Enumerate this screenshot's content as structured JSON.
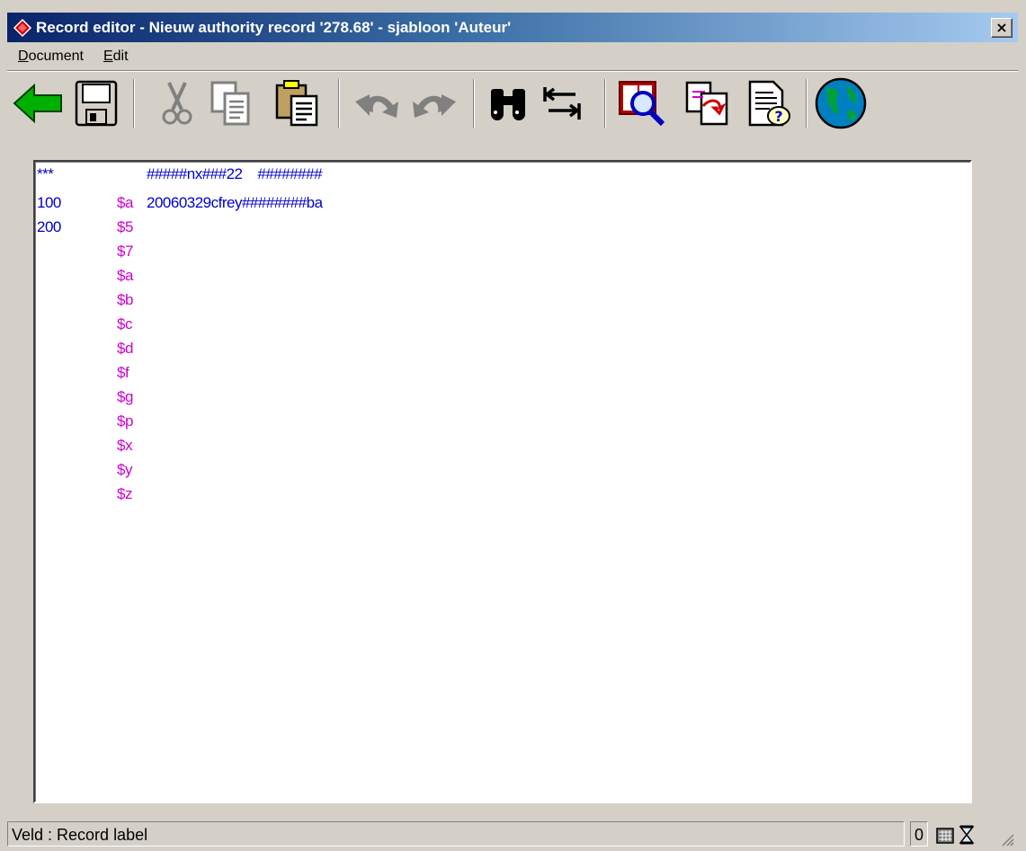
{
  "window": {
    "title": "Record editor - Nieuw authority record '278.68' - sjabloon 'Auteur'",
    "close_label": "×",
    "title_gradient": [
      "#0a246a",
      "#a6caf0"
    ]
  },
  "menu": [
    {
      "label_u": "D",
      "label_rest": "ocument"
    },
    {
      "label_u": "E",
      "label_rest": "dit"
    }
  ],
  "toolbar": [
    {
      "name": "back-icon"
    },
    {
      "name": "save-icon"
    },
    {
      "name": "cut-icon"
    },
    {
      "name": "copy-icon"
    },
    {
      "name": "paste-icon"
    },
    {
      "name": "undo-icon"
    },
    {
      "name": "redo-icon"
    },
    {
      "name": "find-icon"
    },
    {
      "name": "swap-icon"
    },
    {
      "name": "search-record-icon"
    },
    {
      "name": "copy-record-icon"
    },
    {
      "name": "help-document-icon"
    },
    {
      "name": "globe-icon"
    }
  ],
  "record": {
    "rows": [
      {
        "tag": "***",
        "sub": "",
        "value": "#####nx###22    ########"
      },
      {
        "tag": "100",
        "sub": "$a",
        "value": "20060329cfrey########ba"
      },
      {
        "tag": "200",
        "sub": "$5",
        "value": ""
      },
      {
        "tag": "",
        "sub": "$7",
        "value": ""
      },
      {
        "tag": "",
        "sub": "$a",
        "value": ""
      },
      {
        "tag": "",
        "sub": "$b",
        "value": ""
      },
      {
        "tag": "",
        "sub": "$c",
        "value": ""
      },
      {
        "tag": "",
        "sub": "$d",
        "value": ""
      },
      {
        "tag": "",
        "sub": "$f",
        "value": ""
      },
      {
        "tag": "",
        "sub": "$g",
        "value": ""
      },
      {
        "tag": "",
        "sub": "$p",
        "value": ""
      },
      {
        "tag": "",
        "sub": "$x",
        "value": ""
      },
      {
        "tag": "",
        "sub": "$y",
        "value": ""
      },
      {
        "tag": "",
        "sub": "$z",
        "value": ""
      }
    ],
    "colors": {
      "tag": "#0000cc",
      "subfield": "#cc00cc",
      "value": "#0000cc"
    }
  },
  "status": {
    "text": "Veld : Record label",
    "count": "0"
  }
}
